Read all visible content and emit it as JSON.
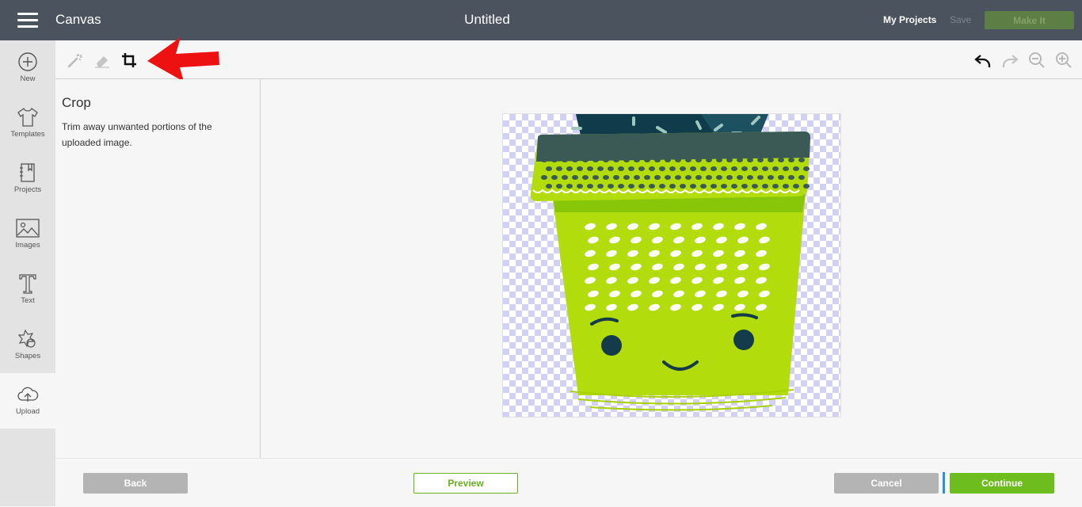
{
  "header": {
    "app_title": "Canvas",
    "doc_title": "Untitled",
    "my_projects": "My Projects",
    "save": "Save",
    "make_it": "Make It"
  },
  "sidebar": {
    "items": [
      {
        "label": "New",
        "icon": "plus-circle-icon"
      },
      {
        "label": "Templates",
        "icon": "shirt-icon"
      },
      {
        "label": "Projects",
        "icon": "notebook-icon"
      },
      {
        "label": "Images",
        "icon": "image-icon"
      },
      {
        "label": "Text",
        "icon": "text-icon"
      },
      {
        "label": "Shapes",
        "icon": "shapes-icon"
      },
      {
        "label": "Upload",
        "icon": "cloud-upload-icon"
      }
    ],
    "active": "Upload"
  },
  "toolbar": {
    "left_tools": [
      "magic-wand-icon",
      "eraser-icon",
      "crop-icon"
    ],
    "right_tools": [
      "undo-icon",
      "redo-icon",
      "zoom-out-icon",
      "zoom-in-icon"
    ],
    "annotation": "red-arrow-icon"
  },
  "panel": {
    "title": "Crop",
    "description": "Trim away unwanted portions of the uploaded image."
  },
  "canvas": {
    "image": "cactus-pot-illustration",
    "background": "transparency-checkerboard"
  },
  "footer": {
    "back": "Back",
    "preview": "Preview",
    "cancel": "Cancel",
    "continue": "Continue"
  },
  "colors": {
    "topbar": "#4b545e",
    "accent_green": "#6ebd1f",
    "make_it": "#5d7e45",
    "checker": "#d2d0f4",
    "annotation_red": "#ee1111"
  }
}
